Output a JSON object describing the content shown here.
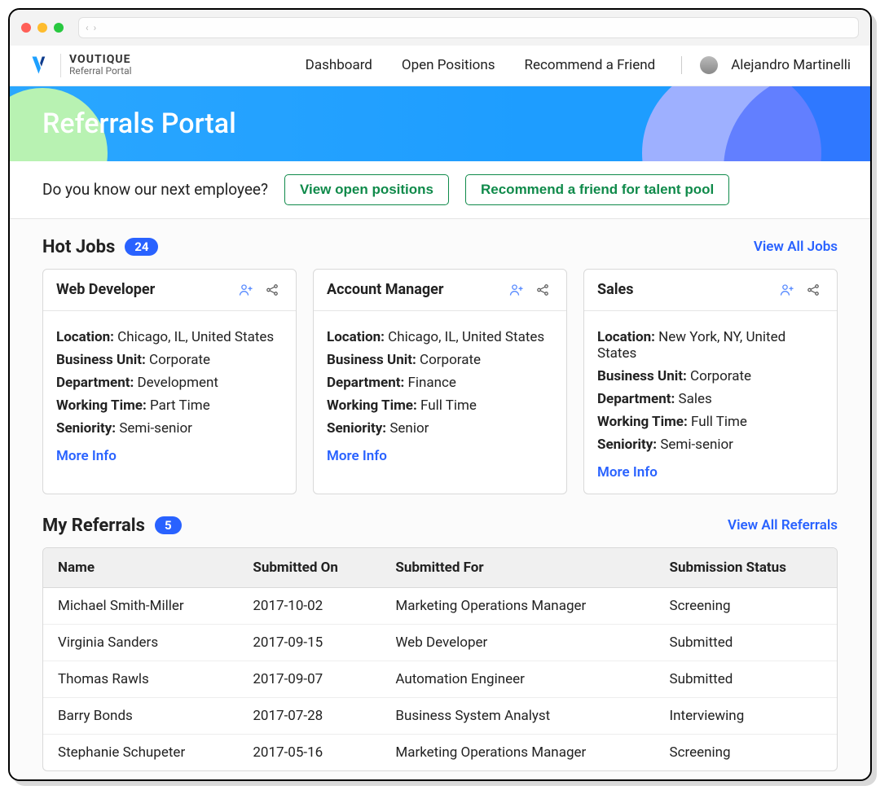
{
  "brand": {
    "name": "VOUTIQUE",
    "sub": "Referral Portal"
  },
  "nav": {
    "items": [
      "Dashboard",
      "Open Positions",
      "Recommend a Friend"
    ],
    "username": "Alejandro Martinelli"
  },
  "hero": {
    "title": "Referrals Portal"
  },
  "cta": {
    "prompt": "Do you know our next employee?",
    "btn1": "View open positions",
    "btn2": "Recommend a friend for talent pool"
  },
  "hotjobs": {
    "title": "Hot Jobs",
    "count": "24",
    "view_all": "View All Jobs",
    "labels": {
      "location": "Location:",
      "bu": "Business Unit:",
      "dept": "Department:",
      "wt": "Working Time:",
      "seniority": "Seniority:",
      "more": "More Info"
    },
    "cards": [
      {
        "title": "Web Developer",
        "location": "Chicago, IL, United States",
        "bu": "Corporate",
        "dept": "Development",
        "wt": "Part Time",
        "seniority": "Semi-senior"
      },
      {
        "title": "Account Manager",
        "location": "Chicago, IL, United States",
        "bu": "Corporate",
        "dept": "Finance",
        "wt": "Full Time",
        "seniority": "Senior"
      },
      {
        "title": "Sales",
        "location": "New York, NY, United States",
        "bu": "Corporate",
        "dept": "Sales",
        "wt": "Full Time",
        "seniority": "Semi-senior"
      }
    ]
  },
  "referrals": {
    "title": "My Referrals",
    "count": "5",
    "view_all": "View All Referrals",
    "columns": [
      "Name",
      "Submitted On",
      "Submitted For",
      "Submission Status"
    ],
    "rows": [
      {
        "name": "Michael Smith-Miller",
        "on": "2017-10-02",
        "for": "Marketing Operations Manager",
        "status": "Screening"
      },
      {
        "name": "Virginia Sanders",
        "on": "2017-09-15",
        "for": "Web Developer",
        "status": "Submitted"
      },
      {
        "name": "Thomas Rawls",
        "on": "2017-09-07",
        "for": "Automation Engineer",
        "status": "Submitted"
      },
      {
        "name": "Barry Bonds",
        "on": "2017-07-28",
        "for": "Business System Analyst",
        "status": "Interviewing"
      },
      {
        "name": "Stephanie Schupeter",
        "on": "2017-05-16",
        "for": "Marketing Operations Manager",
        "status": "Screening"
      }
    ]
  }
}
